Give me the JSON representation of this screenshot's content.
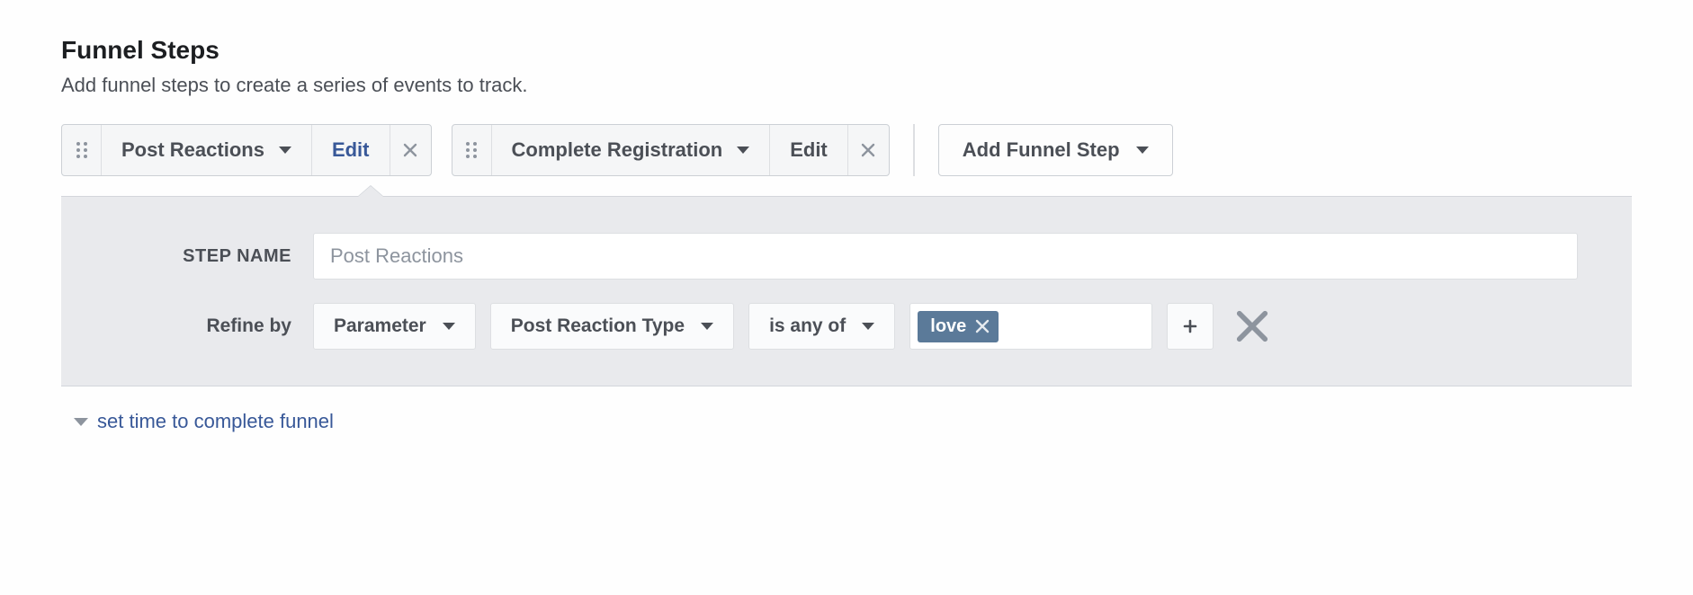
{
  "header": {
    "title": "Funnel Steps",
    "subtitle": "Add funnel steps to create a series of events to track."
  },
  "steps": [
    {
      "label": "Post Reactions",
      "edit_label": "Edit",
      "active": true
    },
    {
      "label": "Complete Registration",
      "edit_label": "Edit",
      "active": false
    }
  ],
  "add_step_label": "Add Funnel Step",
  "editor": {
    "step_name_label": "STEP NAME",
    "step_name_placeholder": "Post Reactions",
    "refine_label": "Refine by",
    "parameter_label": "Parameter",
    "field_label": "Post Reaction Type",
    "operator_label": "is any of",
    "tags": [
      "love"
    ]
  },
  "set_time_label": "set time to complete funnel"
}
